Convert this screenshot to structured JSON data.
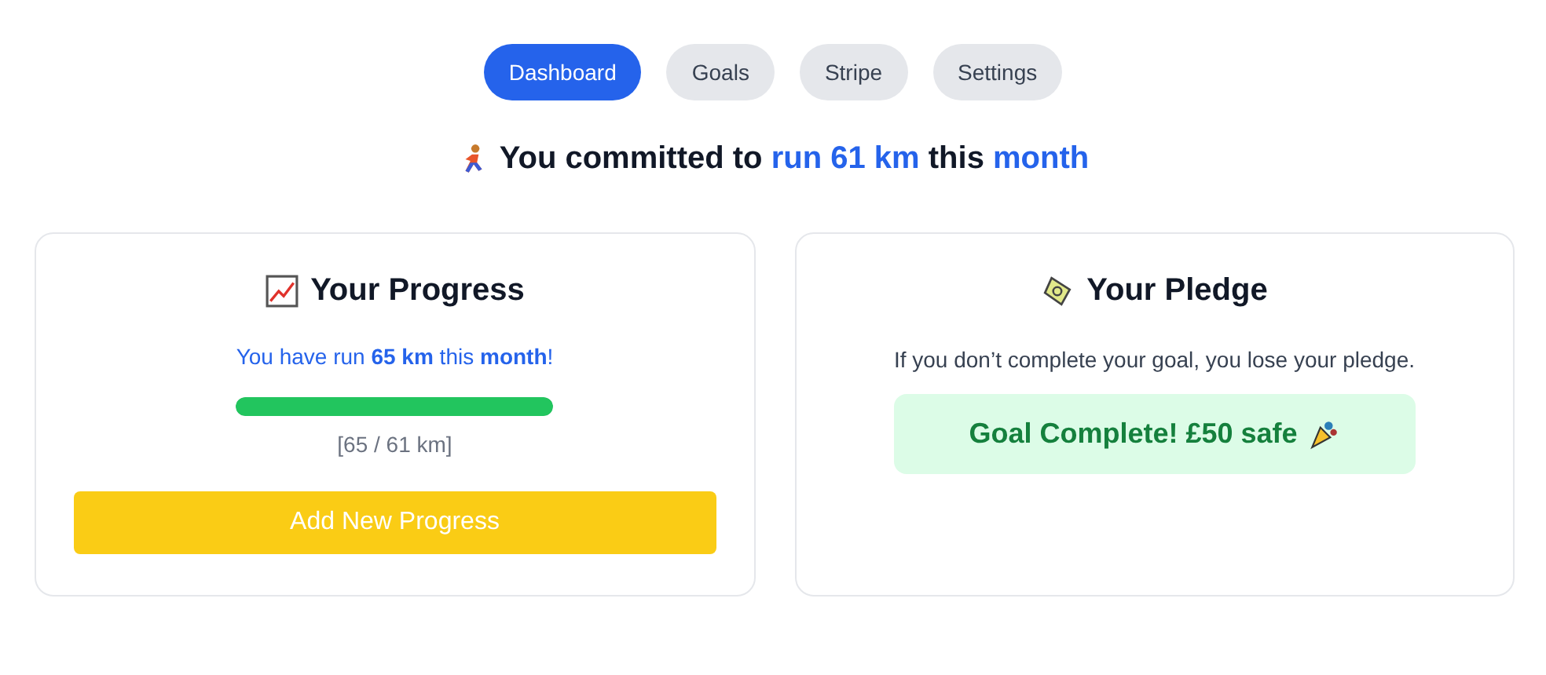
{
  "tabs": [
    {
      "label": "Dashboard",
      "selected": true
    },
    {
      "label": "Goals",
      "selected": false
    },
    {
      "label": "Stripe",
      "selected": false
    },
    {
      "label": "Settings",
      "selected": false
    }
  ],
  "headline": [
    {
      "text": "You committed to",
      "highlight": false
    },
    {
      "text": "run 61 km",
      "highlight": true
    },
    {
      "text": "this",
      "highlight": false
    },
    {
      "text": "month",
      "highlight": true
    }
  ],
  "progress_card": {
    "title": "Your Progress",
    "summary": "You have run **65 km** this **month**!",
    "level": 1,
    "reading": "[65 / 61 km]",
    "button": "Add New Progress"
  },
  "pledge_card": {
    "title": "Your Pledge",
    "note": "If you don’t complete your goal, you lose your pledge.",
    "status": "Goal Complete! £50 safe"
  }
}
